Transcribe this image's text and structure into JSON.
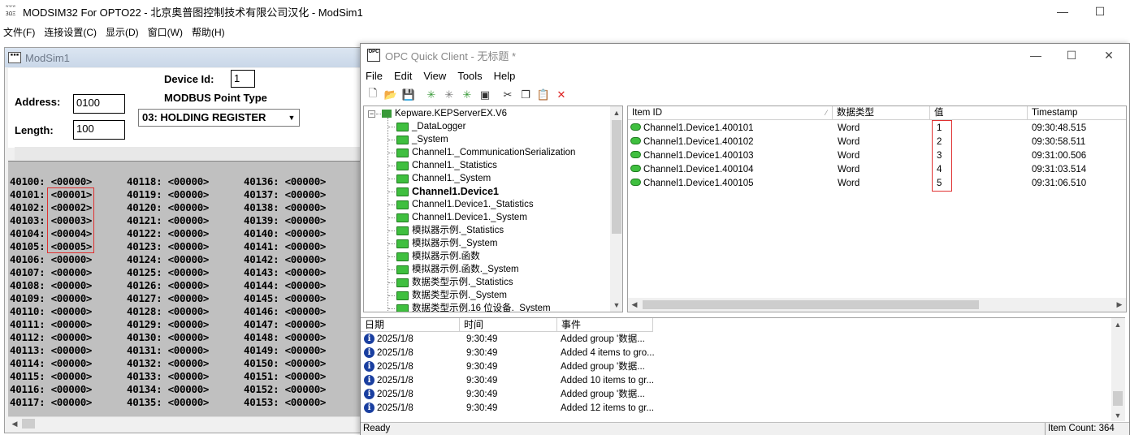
{
  "app": {
    "title": "MODSIM32 For OPTO22 - 北京奥普图控制技术有限公司汉化 - ModSim1",
    "icon_text": "ʷʷʷ 3ΩΞ"
  },
  "menu": [
    "文件(F)",
    "连接设置(C)",
    "显示(D)",
    "窗口(W)",
    "帮助(H)"
  ],
  "modsim": {
    "title": "ModSim1",
    "device_id_label": "Device Id:",
    "device_id": "1",
    "point_type_label": "MODBUS Point Type",
    "address_label": "Address:",
    "address": "0100",
    "length_label": "Length:",
    "length": "100",
    "point_type": "03: HOLDING REGISTER",
    "registers": [
      [
        "40100: <00000>",
        "40101: <00001>",
        "40102: <00002>",
        "40103: <00003>",
        "40104: <00004>",
        "40105: <00005>",
        "40106: <00000>",
        "40107: <00000>",
        "40108: <00000>",
        "40109: <00000>",
        "40110: <00000>",
        "40111: <00000>",
        "40112: <00000>",
        "40113: <00000>",
        "40114: <00000>",
        "40115: <00000>",
        "40116: <00000>",
        "40117: <00000>"
      ],
      [
        "40118: <00000>",
        "40119: <00000>",
        "40120: <00000>",
        "40121: <00000>",
        "40122: <00000>",
        "40123: <00000>",
        "40124: <00000>",
        "40125: <00000>",
        "40126: <00000>",
        "40127: <00000>",
        "40128: <00000>",
        "40129: <00000>",
        "40130: <00000>",
        "40131: <00000>",
        "40132: <00000>",
        "40133: <00000>",
        "40134: <00000>",
        "40135: <00000>"
      ],
      [
        "40136: <00000>",
        "40137: <00000>",
        "40138: <00000>",
        "40139: <00000>",
        "40140: <00000>",
        "40141: <00000>",
        "40142: <00000>",
        "40143: <00000>",
        "40144: <00000>",
        "40145: <00000>",
        "40146: <00000>",
        "40147: <00000>",
        "40148: <00000>",
        "40149: <00000>",
        "40150: <00000>",
        "40151: <00000>",
        "40152: <00000>",
        "40153: <00000>"
      ]
    ]
  },
  "opc": {
    "title": "OPC Quick Client - 无标题 *",
    "logo_text": "OPC",
    "menu": [
      "File",
      "Edit",
      "View",
      "Tools",
      "Help"
    ],
    "tree_root": "Kepware.KEPServerEX.V6",
    "tree_items": [
      "_DataLogger",
      "_System",
      "Channel1._CommunicationSerialization",
      "Channel1._Statistics",
      "Channel1._System",
      "Channel1.Device1",
      "Channel1.Device1._Statistics",
      "Channel1.Device1._System",
      "模拟器示例._Statistics",
      "模拟器示例._System",
      "模拟器示例.函数",
      "模拟器示例.函数._System",
      "数据类型示例._Statistics",
      "数据类型示例._System",
      "数据类型示例.16 位设备._System"
    ],
    "columns": [
      "Item ID",
      "数据类型",
      "值",
      "Timestamp"
    ],
    "rows": [
      {
        "id": "Channel1.Device1.400101",
        "type": "Word",
        "value": "1",
        "ts": "09:30:48.515"
      },
      {
        "id": "Channel1.Device1.400102",
        "type": "Word",
        "value": "2",
        "ts": "09:30:58.511"
      },
      {
        "id": "Channel1.Device1.400103",
        "type": "Word",
        "value": "3",
        "ts": "09:31:00.506"
      },
      {
        "id": "Channel1.Device1.400104",
        "type": "Word",
        "value": "4",
        "ts": "09:31:03.514"
      },
      {
        "id": "Channel1.Device1.400105",
        "type": "Word",
        "value": "5",
        "ts": "09:31:06.510"
      }
    ],
    "log_columns": [
      "日期",
      "时间",
      "事件"
    ],
    "log": [
      {
        "date": "2025/1/8",
        "time": "9:30:49",
        "event": "Added group '数据..."
      },
      {
        "date": "2025/1/8",
        "time": "9:30:49",
        "event": "Added 4 items to gro..."
      },
      {
        "date": "2025/1/8",
        "time": "9:30:49",
        "event": "Added group '数据..."
      },
      {
        "date": "2025/1/8",
        "time": "9:30:49",
        "event": "Added 10 items to gr..."
      },
      {
        "date": "2025/1/8",
        "time": "9:30:49",
        "event": "Added group '数据..."
      },
      {
        "date": "2025/1/8",
        "time": "9:30:49",
        "event": "Added 12 items to gr..."
      }
    ],
    "status_left": "Ready",
    "status_right": "Item Count: 364"
  }
}
